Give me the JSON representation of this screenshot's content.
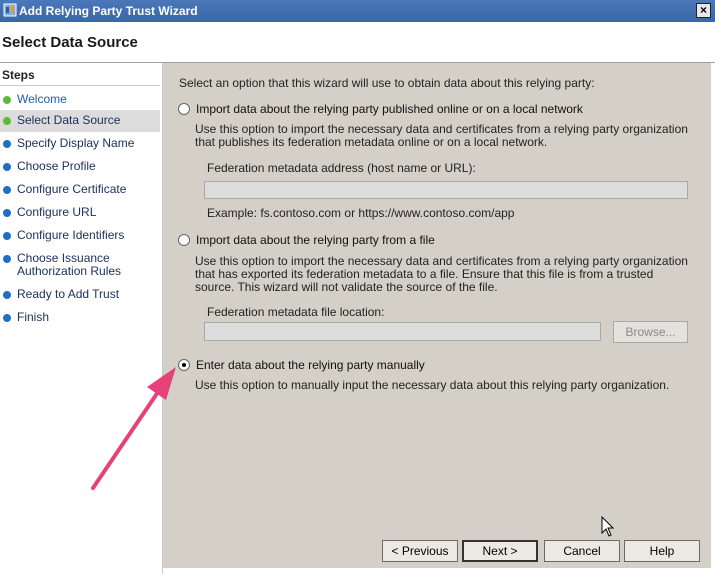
{
  "window": {
    "title": "Add Relying Party Trust Wizard",
    "close_glyph": "×"
  },
  "header": {
    "page_title": "Select Data Source"
  },
  "steps": {
    "title": "Steps",
    "items": [
      {
        "label": "Welcome",
        "status": "complete"
      },
      {
        "label": "Select Data Source",
        "status": "current"
      },
      {
        "label": "Specify Display Name",
        "status": "pending"
      },
      {
        "label": "Choose Profile",
        "status": "pending"
      },
      {
        "label": "Configure Certificate",
        "status": "pending"
      },
      {
        "label": "Configure URL",
        "status": "pending"
      },
      {
        "label": "Configure Identifiers",
        "status": "pending"
      },
      {
        "label": "Choose Issuance Authorization Rules",
        "status": "pending"
      },
      {
        "label": "Ready to Add Trust",
        "status": "pending"
      },
      {
        "label": "Finish",
        "status": "pending"
      }
    ]
  },
  "content": {
    "intro": "Select an option that this wizard will use to obtain data about this relying party:",
    "option_online": {
      "label": "Import data about the relying party published online or on a local network",
      "description": "Use this option to import the necessary data and certificates from a relying party organization that publishes its federation metadata online or on a local network.",
      "field_label": "Federation metadata address (host name or URL):",
      "value": "",
      "example": "Example: fs.contoso.com or https://www.contoso.com/app",
      "selected": false
    },
    "option_file": {
      "label": "Import data about the relying party from a file",
      "description": "Use this option to import the necessary data and certificates from a relying party organization that has exported its federation metadata to a file. Ensure that this file is from a trusted source.  This wizard will not validate the source of the file.",
      "field_label": "Federation metadata file location:",
      "value": "",
      "browse_label": "Browse...",
      "selected": false
    },
    "option_manual": {
      "label": "Enter data about the relying party manually",
      "description": "Use this option to manually input the necessary data about this relying party organization.",
      "selected": true
    }
  },
  "buttons": {
    "previous": "< Previous",
    "next": "Next >",
    "cancel": "Cancel",
    "help": "Help"
  },
  "colors": {
    "accent_arrow": "#e8407a",
    "title_bar": "#3a66a8",
    "content_bg": "#d4d0c8"
  }
}
